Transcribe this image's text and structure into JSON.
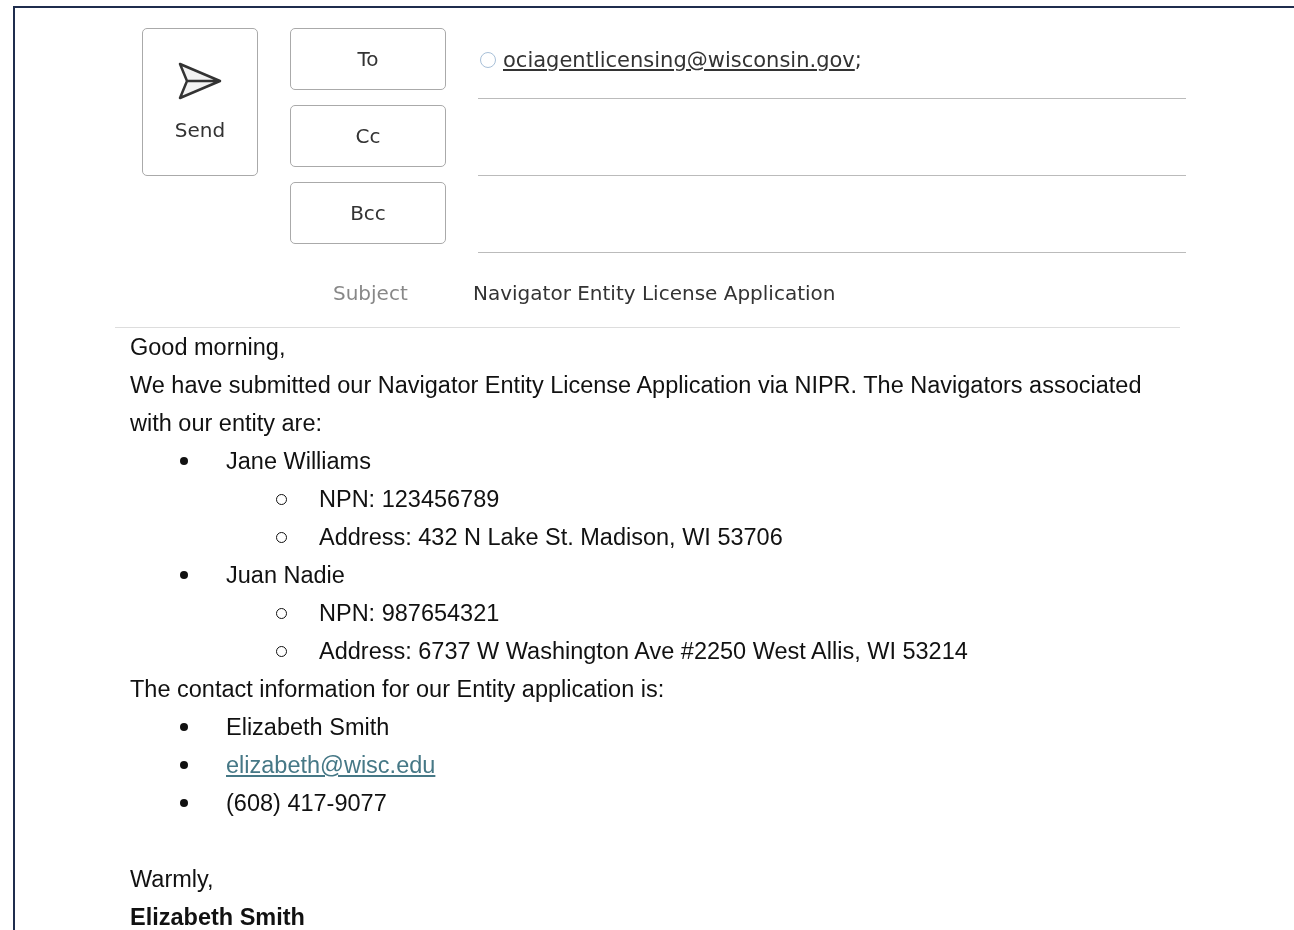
{
  "compose": {
    "send_label": "Send",
    "recipient_buttons": [
      "To",
      "Cc",
      "Bcc"
    ],
    "to": {
      "address": "ociagentlicensing@wisconsin.gov",
      "suffix": ";"
    },
    "subject_label": "Subject",
    "subject": "Navigator Entity License Application"
  },
  "body": [
    {
      "kind": "paragraph",
      "text": "Good morning,"
    },
    {
      "kind": "paragraph",
      "text": "We have submitted our Navigator Entity License Application via NIPR. The Navigators associated with our entity are:"
    },
    {
      "kind": "list",
      "items": [
        {
          "kind": "text",
          "text": "Jane Williams",
          "children": [
            {
              "kind": "text",
              "text": "NPN: 123456789"
            },
            {
              "kind": "text",
              "text": "Address: 432 N Lake St. Madison, WI 53706"
            }
          ]
        },
        {
          "kind": "text",
          "text": "Juan Nadie",
          "children": [
            {
              "kind": "text",
              "text": "NPN: 987654321"
            },
            {
              "kind": "text",
              "text": "Address: 6737 W Washington Ave #2250 West Allis, WI 53214"
            }
          ]
        }
      ]
    },
    {
      "kind": "paragraph",
      "text": "The contact information for our Entity application is:"
    },
    {
      "kind": "list",
      "items": [
        {
          "kind": "text",
          "text": "Elizabeth Smith"
        },
        {
          "kind": "link",
          "text": "elizabeth@wisc.edu"
        },
        {
          "kind": "text",
          "text": "(608) 417-9077"
        }
      ]
    },
    {
      "kind": "closing",
      "text": "Warmly,"
    },
    {
      "kind": "signature",
      "text": "Elizabeth Smith"
    }
  ]
}
